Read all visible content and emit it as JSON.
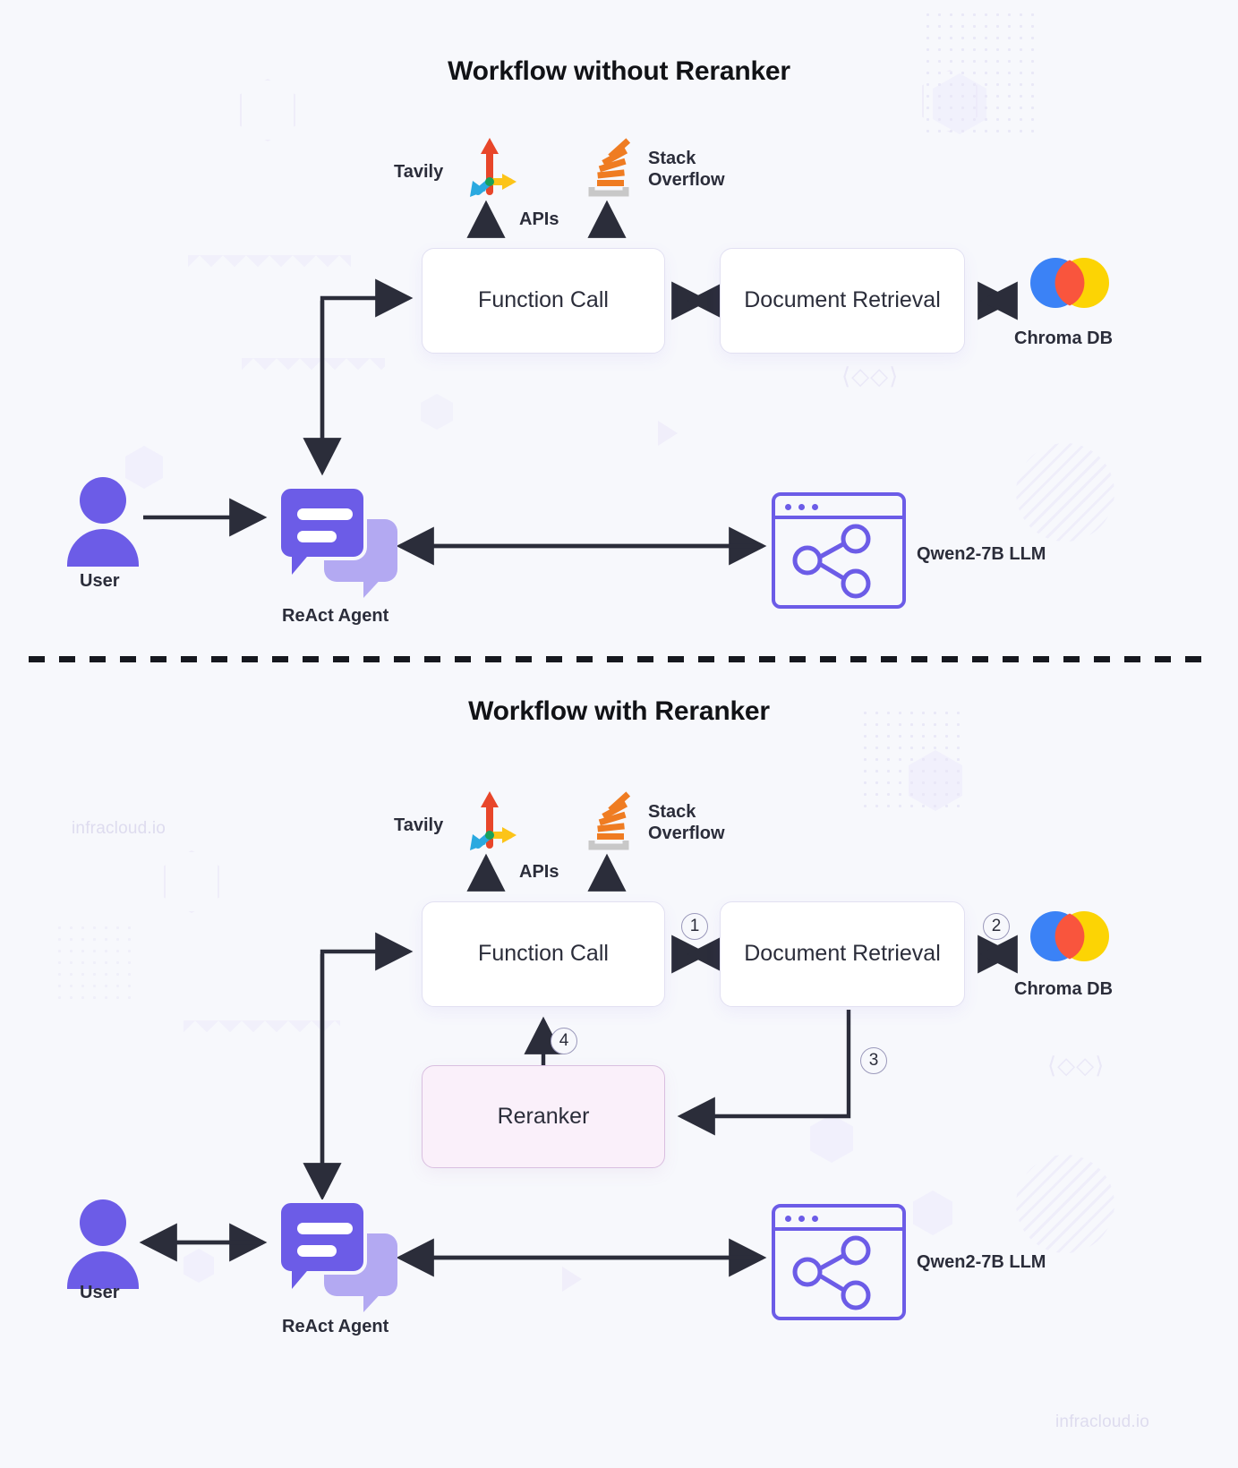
{
  "page": {
    "background_color": "#f7f8fc",
    "accent_purple": "#6c5ce7",
    "arrow_color": "#2b2d3a",
    "watermark": "infracloud.io"
  },
  "sections": [
    {
      "id": "without-reranker",
      "title": "Workflow without Reranker",
      "nodes": {
        "function_call": "Function Call",
        "document_retrieval": "Document Retrieval",
        "chroma_db": "Chroma DB",
        "react_agent": "ReAct Agent",
        "user": "User",
        "llm": "Qwen2-7B LLM",
        "tavily": "Tavily",
        "stack_overflow": "Stack Overflow",
        "apis": "APIs"
      }
    },
    {
      "id": "with-reranker",
      "title": "Workflow with Reranker",
      "nodes": {
        "function_call": "Function Call",
        "document_retrieval": "Document Retrieval",
        "chroma_db": "Chroma DB",
        "reranker": "Reranker",
        "react_agent": "ReAct Agent",
        "user": "User",
        "llm": "Qwen2-7B LLM",
        "tavily": "Tavily",
        "stack_overflow": "Stack Overflow",
        "apis": "APIs"
      },
      "step_numbers": [
        "1",
        "2",
        "3",
        "4"
      ]
    }
  ],
  "icons": {
    "user": "user-icon",
    "agent": "chat-bubbles-icon",
    "chroma": "chroma-db-logo",
    "tavily": "tavily-axes-logo",
    "stackoverflow": "stack-overflow-logo",
    "llm": "browser-network-icon"
  }
}
